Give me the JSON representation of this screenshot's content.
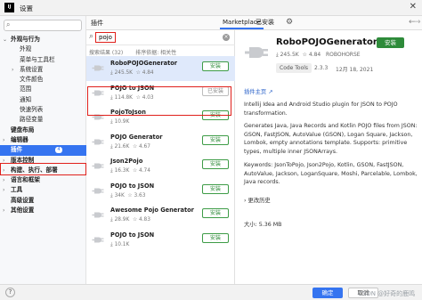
{
  "window": {
    "app_icon_text": "IJ",
    "title": "设置",
    "close_glyph": "✕"
  },
  "sidebar": {
    "items": [
      {
        "label": "外观与行为",
        "level": 0,
        "bold": true,
        "expanded": true
      },
      {
        "label": "外观",
        "level": 1
      },
      {
        "label": "菜单与工具栏",
        "level": 1
      },
      {
        "label": "系统设置",
        "level": 1,
        "collapsed": true
      },
      {
        "label": "文件颜色",
        "level": 1
      },
      {
        "label": "范围",
        "level": 1
      },
      {
        "label": "通知",
        "level": 1
      },
      {
        "label": "快速列表",
        "level": 1
      },
      {
        "label": "路径变量",
        "level": 1
      },
      {
        "label": "键盘布局",
        "level": 0,
        "bold": true
      },
      {
        "label": "编辑器",
        "level": 0,
        "bold": true,
        "collapsed": true
      },
      {
        "label": "插件",
        "level": 0,
        "bold": true,
        "selected": true,
        "badge": "4"
      },
      {
        "label": "版本控制",
        "level": 0,
        "bold": true,
        "collapsed": true
      },
      {
        "label": "构建、执行、部署",
        "level": 0,
        "bold": true,
        "collapsed": true
      },
      {
        "label": "语言和框架",
        "level": 0,
        "bold": true,
        "collapsed": true
      },
      {
        "label": "工具",
        "level": 0,
        "bold": true,
        "collapsed": true
      },
      {
        "label": "高级设置",
        "level": 0,
        "bold": true
      },
      {
        "label": "其他设置",
        "level": 0,
        "bold": true,
        "collapsed": true
      }
    ]
  },
  "tabs": {
    "plugins_label": "插件",
    "marketplace_label": "Marketplace",
    "installed_label": "已安装",
    "active": "Marketplace"
  },
  "search": {
    "query": "pojo",
    "results_label": "搜索结果 (32)",
    "sort_label": "排序依据: 相关性"
  },
  "plugins": [
    {
      "name": "RoboPOJOGenerator",
      "downloads": "245.5K",
      "rating": "4.84",
      "action": "安装",
      "selected": true
    },
    {
      "name": "POJO to JSON",
      "downloads": "114.8K",
      "rating": "4.03",
      "action": "已安装"
    },
    {
      "name": "PojoToJson",
      "downloads": "10.9K",
      "rating": "",
      "action": "安装"
    },
    {
      "name": "POJO Generator",
      "downloads": "21.6K",
      "rating": "4.67",
      "action": "安装"
    },
    {
      "name": "Json2Pojo",
      "downloads": "16.3K",
      "rating": "4.74",
      "action": "安装"
    },
    {
      "name": "POJO to JSON",
      "downloads": "34K",
      "rating": "3.63",
      "action": "安装"
    },
    {
      "name": "Awesome Pojo Generator",
      "downloads": "28.9K",
      "rating": "4.83",
      "action": "安装"
    },
    {
      "name": "POJO to JSON",
      "downloads": "10.1K",
      "rating": "",
      "action": "安装"
    }
  ],
  "detail": {
    "name": "RoboPOJOGenerator",
    "install_label": "安装",
    "downloads": "245.5K",
    "rating": "4.84",
    "vendor": "ROBOHORSE",
    "tag": "Code Tools",
    "version": "2.3.3",
    "date": "12月 18, 2021",
    "homepage": "插件主页 ↗",
    "desc1": "Intellij Idea and Android Studio plugin for JSON to POJO transformation.",
    "desc2": "Generates Java, Java Records and Kotlin POJO files from JSON: GSON, FastJSON, AutoValue (GSON), Logan Square, Jackson, Lombok, empty annotations template. Supports: primitive types, multiple inner JSONArrays.",
    "desc3": "Keywords: JsonToPojo, Json2Pojo, Kotlin, GSON, FastJSON, AutoValue, Jackson, LoganSquare, Moshi, Parcelable, Lombok, Java records.",
    "more_label": "› 更改历史",
    "size_label": "大小: 5.36 MB"
  },
  "footer": {
    "help": "?",
    "ok_label": "确定",
    "cancel_label": "取消",
    "watermark": "CSDN @好奇的鹿鸣"
  },
  "colors": {
    "accent": "#3574f0",
    "install_green": "#2e8b3a",
    "highlight_red": "#e0201b"
  },
  "icons": [
    "search-icon",
    "gear-icon",
    "plug-icon",
    "star-icon",
    "download-icon",
    "chevron-right-icon",
    "chevron-down-icon",
    "close-icon",
    "help-icon"
  ]
}
